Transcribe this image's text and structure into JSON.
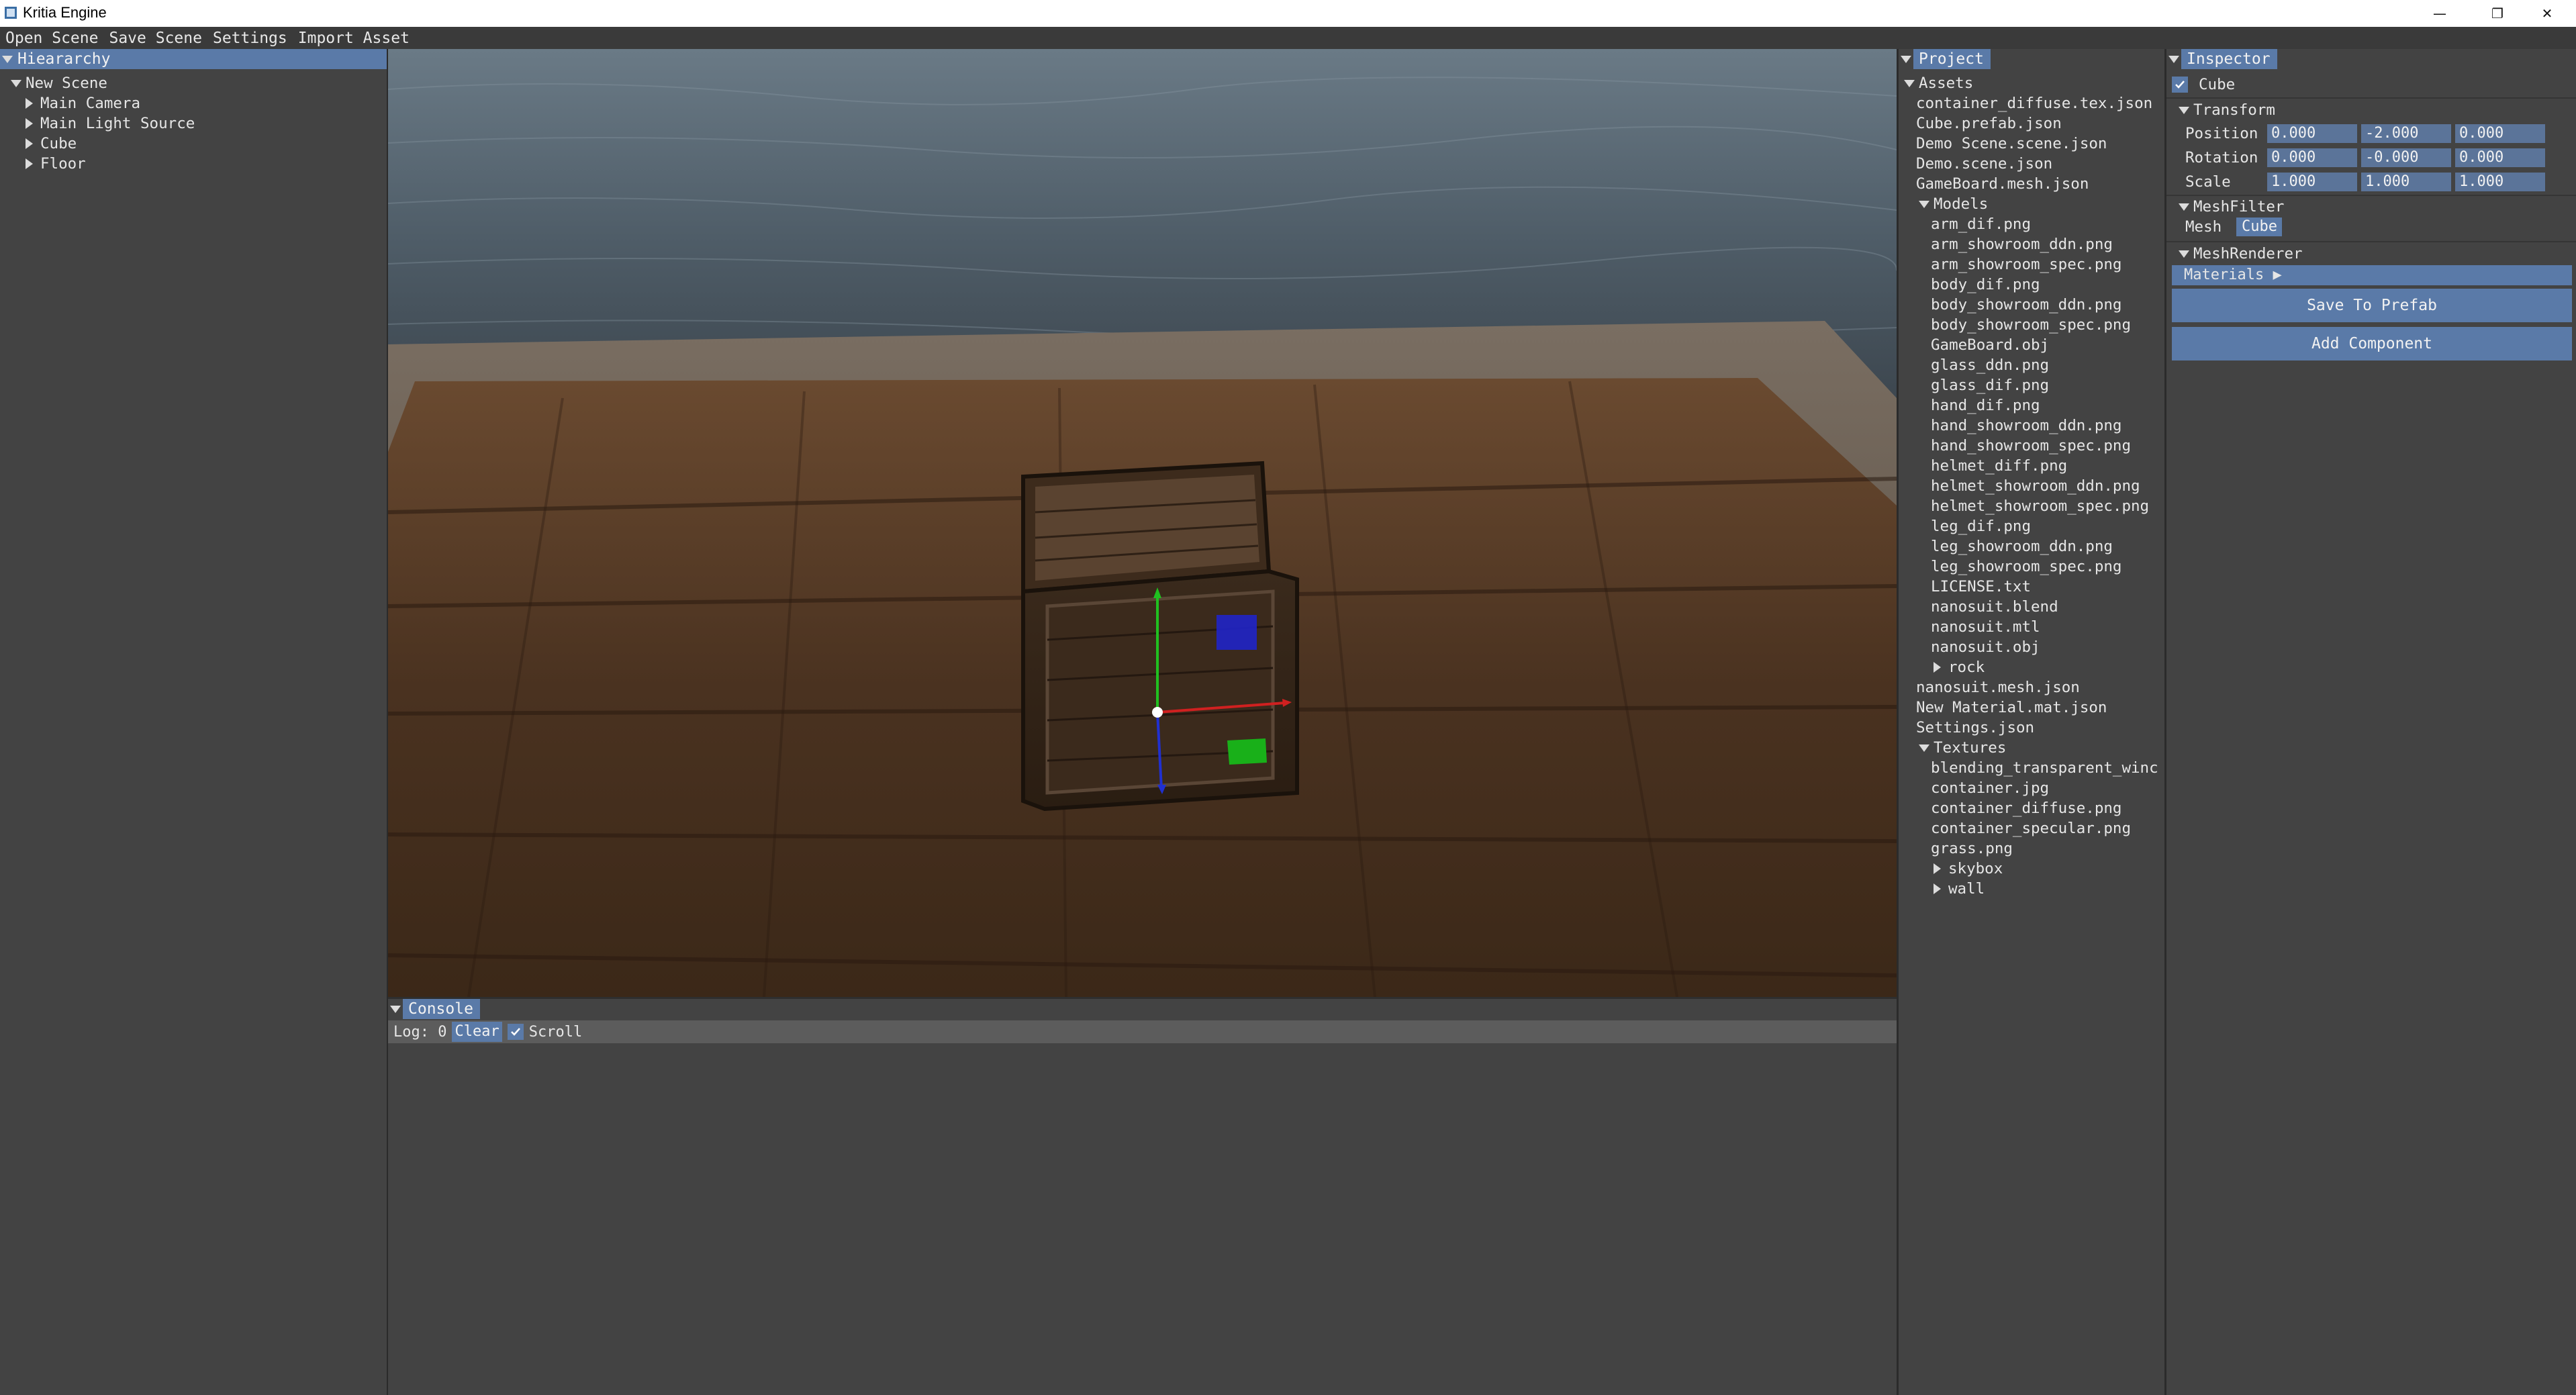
{
  "window": {
    "title": "Kritia Engine",
    "minimize_glyph": "—",
    "restore_glyph": "❐",
    "close_glyph": "✕"
  },
  "menu": [
    "Open Scene",
    "Save Scene",
    "Settings",
    "Import Asset"
  ],
  "hierarchy": {
    "title": "Hieararchy",
    "scene": "New Scene",
    "items": [
      "Main Camera",
      "Main Light Source",
      "Cube",
      "Floor"
    ]
  },
  "project": {
    "title": "Project",
    "root": "Assets",
    "files_top": [
      "container_diffuse.tex.json",
      "Cube.prefab.json",
      "Demo Scene.scene.json",
      "Demo.scene.json",
      "GameBoard.mesh.json"
    ],
    "models_folder": "Models",
    "models_files": [
      "arm_dif.png",
      "arm_showroom_ddn.png",
      "arm_showroom_spec.png",
      "body_dif.png",
      "body_showroom_ddn.png",
      "body_showroom_spec.png",
      "GameBoard.obj",
      "glass_ddn.png",
      "glass_dif.png",
      "hand_dif.png",
      "hand_showroom_ddn.png",
      "hand_showroom_spec.png",
      "helmet_diff.png",
      "helmet_showroom_ddn.png",
      "helmet_showroom_spec.png",
      "leg_dif.png",
      "leg_showroom_ddn.png",
      "leg_showroom_spec.png",
      "LICENSE.txt",
      "nanosuit.blend",
      "nanosuit.mtl",
      "nanosuit.obj"
    ],
    "models_subfolder": "rock",
    "files_mid": [
      "nanosuit.mesh.json",
      "New Material.mat.json",
      "Settings.json"
    ],
    "textures_folder": "Textures",
    "textures_files": [
      "blending_transparent_winc",
      "container.jpg",
      "container_diffuse.png",
      "container_specular.png",
      "grass.png"
    ],
    "textures_subfolders": [
      "skybox",
      "wall"
    ]
  },
  "inspector": {
    "title": "Inspector",
    "object_name": "Cube",
    "object_enabled": true,
    "transform": {
      "header": "Transform",
      "position_label": "Position",
      "rotation_label": "Rotation",
      "scale_label": "Scale",
      "position": [
        "0.000",
        "-2.000",
        "0.000"
      ],
      "rotation": [
        "0.000",
        "-0.000",
        "0.000"
      ],
      "scale": [
        "1.000",
        "1.000",
        "1.000"
      ]
    },
    "meshfilter": {
      "header": "MeshFilter",
      "mesh_label": "Mesh",
      "mesh_value": "Cube"
    },
    "meshrenderer": {
      "header": "MeshRenderer",
      "materials_label": "Materials ▶"
    },
    "save_prefab": "Save To Prefab",
    "add_component": "Add Component"
  },
  "console": {
    "title": "Console",
    "log_label": "Log: 0",
    "clear_label": "Clear",
    "scroll_label": "Scroll",
    "scroll_enabled": true
  },
  "colors": {
    "accent": "#5a7aa8",
    "panel_bg": "#434343",
    "field_bg": "#5b7499",
    "gizmo_x": "#d02020",
    "gizmo_y": "#20c020",
    "gizmo_z": "#2030d0"
  }
}
